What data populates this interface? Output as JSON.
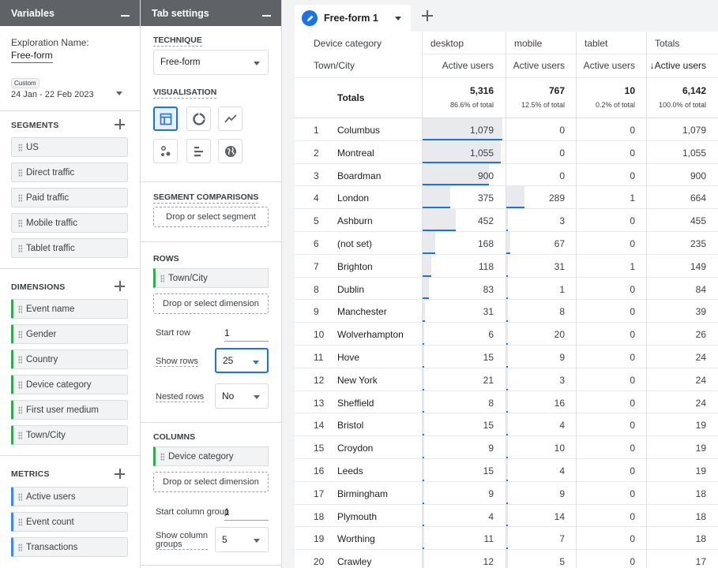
{
  "variables": {
    "title": "Variables",
    "exploration_label": "Exploration Name:",
    "exploration_name": "Free-form",
    "date_tag": "Custom",
    "date_range": "24 Jan - 22 Feb 2023",
    "segments_title": "SEGMENTS",
    "segments": [
      "US",
      "Direct traffic",
      "Paid traffic",
      "Mobile traffic",
      "Tablet traffic"
    ],
    "dimensions_title": "DIMENSIONS",
    "dimensions": [
      "Event name",
      "Gender",
      "Country",
      "Device category",
      "First user medium",
      "Town/City"
    ],
    "metrics_title": "METRICS",
    "metrics": [
      "Active users",
      "Event count",
      "Transactions"
    ]
  },
  "tab_settings": {
    "title": "Tab settings",
    "technique_title": "TECHNIQUE",
    "technique_value": "Free-form",
    "visualisation_title": "VISUALISATION",
    "segment_comparisons_title": "SEGMENT COMPARISONS",
    "segment_drop": "Drop or select segment",
    "rows_title": "ROWS",
    "rows_chip": "Town/City",
    "rows_drop": "Drop or select dimension",
    "start_row_label": "Start row",
    "start_row_value": "1",
    "show_rows_label": "Show rows",
    "show_rows_value": "25",
    "nested_rows_label": "Nested rows",
    "nested_rows_value": "No",
    "columns_title": "COLUMNS",
    "columns_chip": "Device category",
    "columns_drop": "Drop or select dimension",
    "start_col_label": "Start column group",
    "start_col_value": "1",
    "show_col_label_1": "Show column",
    "show_col_label_2": "groups",
    "show_col_value": "5"
  },
  "canvas": {
    "tab_label": "Free-form 1",
    "header": {
      "col_dim": "Device category",
      "row_dim": "Town/City",
      "columns": [
        "desktop",
        "mobile",
        "tablet",
        "Totals"
      ],
      "metric": "Active users",
      "sorted_metric": "↓Active users"
    },
    "totals": {
      "label": "Totals",
      "values": [
        "5,316",
        "767",
        "10",
        "6,142"
      ],
      "pcts": [
        "86.6% of total",
        "12.5% of total",
        "0.2% of total",
        "100.0% of total"
      ]
    },
    "rows": [
      {
        "n": "1",
        "city": "Columbus",
        "d": "1,079",
        "m": "0",
        "t": "0",
        "tot": "1,079"
      },
      {
        "n": "2",
        "city": "Montreal",
        "d": "1,055",
        "m": "0",
        "t": "0",
        "tot": "1,055"
      },
      {
        "n": "3",
        "city": "Boardman",
        "d": "900",
        "m": "0",
        "t": "0",
        "tot": "900"
      },
      {
        "n": "4",
        "city": "London",
        "d": "375",
        "m": "289",
        "t": "1",
        "tot": "664"
      },
      {
        "n": "5",
        "city": "Ashburn",
        "d": "452",
        "m": "3",
        "t": "0",
        "tot": "455"
      },
      {
        "n": "6",
        "city": "(not set)",
        "d": "168",
        "m": "67",
        "t": "0",
        "tot": "235"
      },
      {
        "n": "7",
        "city": "Brighton",
        "d": "118",
        "m": "31",
        "t": "1",
        "tot": "149"
      },
      {
        "n": "8",
        "city": "Dublin",
        "d": "83",
        "m": "1",
        "t": "0",
        "tot": "84"
      },
      {
        "n": "9",
        "city": "Manchester",
        "d": "31",
        "m": "8",
        "t": "0",
        "tot": "39"
      },
      {
        "n": "10",
        "city": "Wolverhampton",
        "d": "6",
        "m": "20",
        "t": "0",
        "tot": "26"
      },
      {
        "n": "11",
        "city": "Hove",
        "d": "15",
        "m": "9",
        "t": "0",
        "tot": "24"
      },
      {
        "n": "12",
        "city": "New York",
        "d": "21",
        "m": "3",
        "t": "0",
        "tot": "24"
      },
      {
        "n": "13",
        "city": "Sheffield",
        "d": "8",
        "m": "16",
        "t": "0",
        "tot": "24"
      },
      {
        "n": "14",
        "city": "Bristol",
        "d": "15",
        "m": "4",
        "t": "0",
        "tot": "19"
      },
      {
        "n": "15",
        "city": "Croydon",
        "d": "9",
        "m": "10",
        "t": "0",
        "tot": "19"
      },
      {
        "n": "16",
        "city": "Leeds",
        "d": "15",
        "m": "4",
        "t": "0",
        "tot": "19"
      },
      {
        "n": "17",
        "city": "Birmingham",
        "d": "9",
        "m": "9",
        "t": "0",
        "tot": "18"
      },
      {
        "n": "18",
        "city": "Plymouth",
        "d": "4",
        "m": "14",
        "t": "0",
        "tot": "18"
      },
      {
        "n": "19",
        "city": "Worthing",
        "d": "11",
        "m": "7",
        "t": "0",
        "tot": "18"
      },
      {
        "n": "20",
        "city": "Crawley",
        "d": "12",
        "m": "5",
        "t": "0",
        "tot": "17"
      }
    ]
  },
  "colors": {
    "header_bg": "#5f6368",
    "accent": "#1a73e8",
    "dimension": "#34a853",
    "metric": "#4285f4"
  }
}
